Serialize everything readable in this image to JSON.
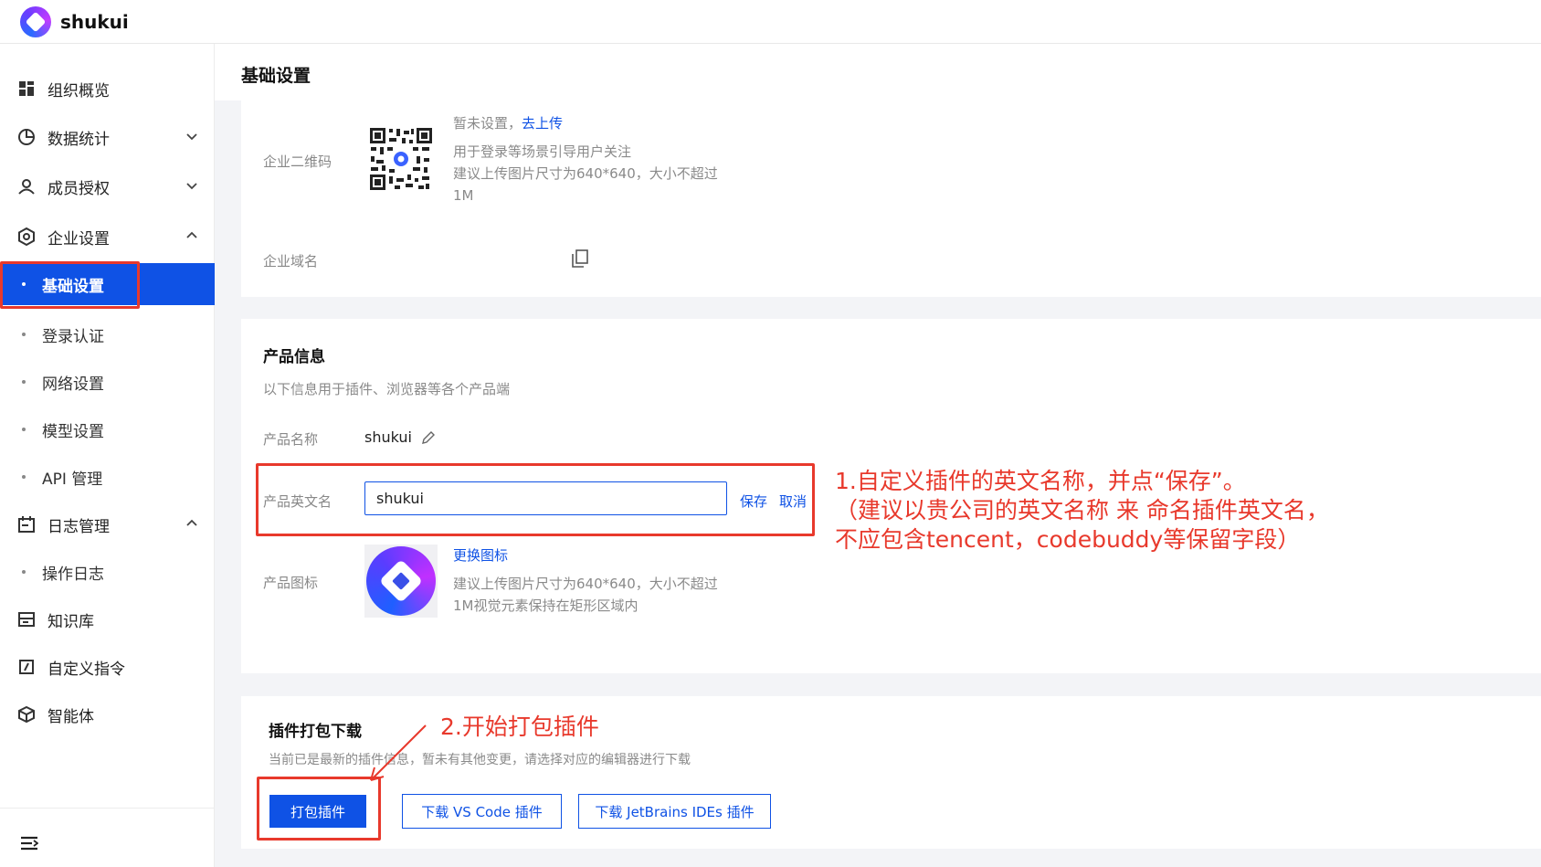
{
  "header": {
    "app_name": "shukui"
  },
  "sidebar": {
    "items": [
      {
        "label": "组织概览",
        "icon": "grid-icon"
      },
      {
        "label": "数据统计",
        "icon": "pie-chart-icon",
        "expanded": false
      },
      {
        "label": "成员授权",
        "icon": "user-icon",
        "expanded": false
      },
      {
        "label": "企业设置",
        "icon": "settings-icon",
        "expanded": true
      },
      {
        "label": "日志管理",
        "icon": "log-calendar-icon",
        "expanded": true
      },
      {
        "label": "知识库",
        "icon": "knowledge-base-icon"
      },
      {
        "label": "自定义指令",
        "icon": "custom-command-icon"
      },
      {
        "label": "智能体",
        "icon": "cube-icon"
      }
    ],
    "enterprise_sub": [
      "基础设置",
      "登录认证",
      "网络设置",
      "模型设置",
      "API 管理"
    ],
    "log_sub": [
      "操作日志"
    ],
    "active_sub": "基础设置"
  },
  "main": {
    "page_title": "基础设置",
    "basic": {
      "qr_label": "企业二维码",
      "qr_status": "暂未设置，",
      "qr_upload_link": "去上传",
      "qr_hint_1": "用于登录等场景引导用户关注",
      "qr_hint_2": "建议上传图片尺寸为640*640，大小不超过",
      "qr_hint_3": "1M",
      "domain_label": "企业域名"
    },
    "product": {
      "title": "产品信息",
      "subtitle": "以下信息用于插件、浏览器等各个产品端",
      "name_label": "产品名称",
      "name_value": "shukui",
      "english_name_label": "产品英文名",
      "english_name_value": "shukui",
      "save_label": "保存",
      "cancel_label": "取消",
      "icon_label": "产品图标",
      "change_icon_link": "更换图标",
      "icon_hint_1": "建议上传图片尺寸为640*640，大小不超过",
      "icon_hint_2": "1M视觉元素保持在矩形区域内"
    },
    "plugin": {
      "title": "插件打包下载",
      "subtitle": "当前已是最新的插件信息，暂未有其他变更，请选择对应的编辑器进行下载",
      "pack_button": "打包插件",
      "vscode_button": "下载 VS Code 插件",
      "jetbrains_button": "下载 JetBrains IDEs 插件"
    }
  },
  "annotations": {
    "step1_line1": "1.自定义插件的英文名称，并点“保存”。",
    "step1_line2": "（建议以贵公司的英文名称 来 命名插件英文名，",
    "step1_line3": "不应包含tencent，codebuddy等保留字段）",
    "step2": "2.开始打包插件",
    "color": "#e8392c"
  },
  "colors": {
    "accent": "#0f52e5",
    "annotation": "#e8392c"
  }
}
